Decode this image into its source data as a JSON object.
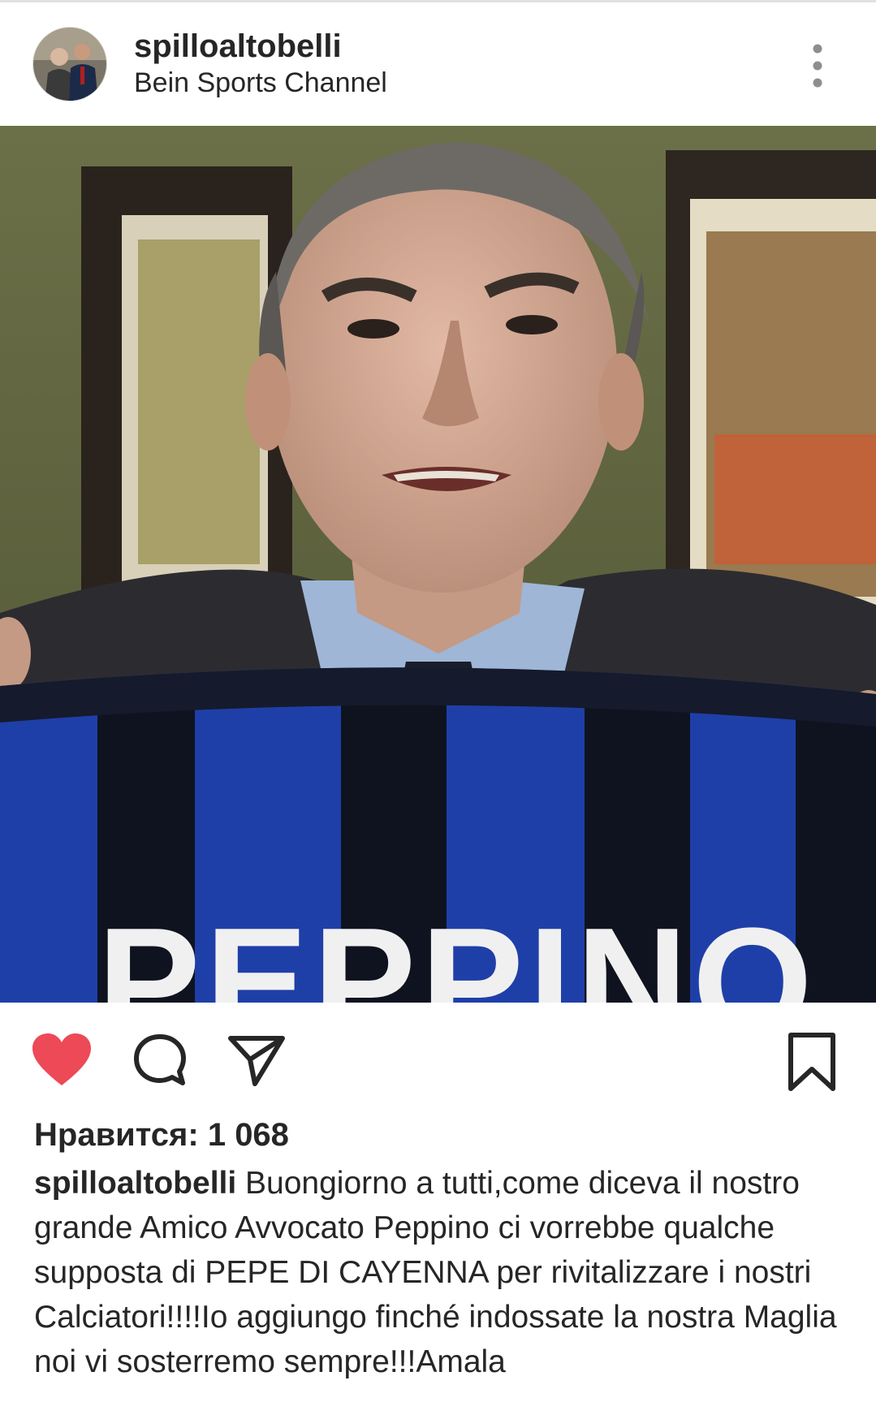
{
  "post": {
    "username": "spilloaltobelli",
    "location": "Bein Sports Channel",
    "photo_text": "PEPPINO",
    "likes_text": "Нравится: 1 068",
    "caption_username": "spilloaltobelli",
    "caption_text": " Buongiorno a tutti,come diceva il nostro grande Amico Avvocato Peppino ci vorrebbe qualche supposta di PEPE DI CAYENNA per rivitalizzare i nostri Calciatori!!!!Io aggiungo finché indossate la nostra Maglia noi vi sosterremo sempre!!!Amala"
  },
  "icons": {
    "more": "more-vertical-icon",
    "like": "heart-icon",
    "comment": "comment-icon",
    "share": "send-icon",
    "save": "bookmark-icon"
  },
  "colors": {
    "like_red": "#ed4956",
    "text": "#262626",
    "jersey_blue": "#1f3fa8"
  }
}
